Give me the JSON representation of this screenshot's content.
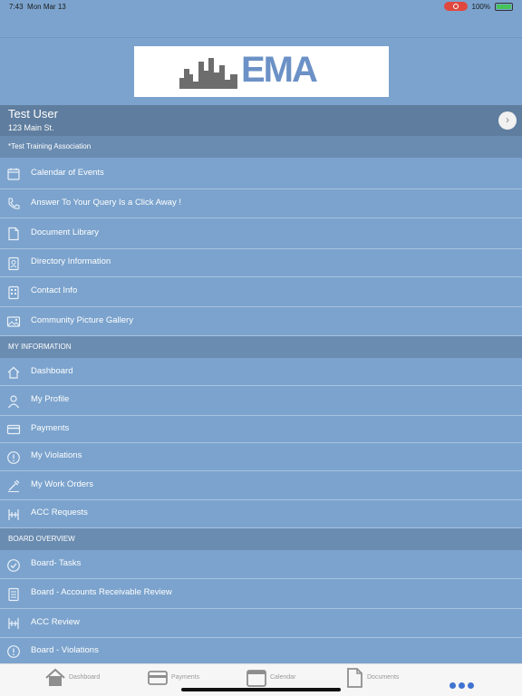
{
  "status_bar": {
    "time": "7:43",
    "date": "Mon Mar 13",
    "battery_percent": "100%",
    "battery_level": 1.0
  },
  "logo": {
    "text": "EMA"
  },
  "user": {
    "name": "Test User",
    "address": "123 Main St."
  },
  "association": {
    "label": "*Test Training Association"
  },
  "association_items": [
    {
      "label": "Calendar of Events",
      "icon": "calendar-icon"
    },
    {
      "label": "Answer To Your Query Is a Click Away !",
      "icon": "phone-icon"
    },
    {
      "label": "Document Library",
      "icon": "document-icon"
    },
    {
      "label": "Directory Information",
      "icon": "contact-card-icon"
    },
    {
      "label": "Contact Info",
      "icon": "building-icon"
    },
    {
      "label": "Community Picture Gallery",
      "icon": "picture-icon"
    }
  ],
  "my_information": {
    "header": "MY INFORMATION",
    "items": [
      {
        "label": "Dashboard",
        "icon": "home-icon"
      },
      {
        "label": "My Profile",
        "icon": "person-icon"
      },
      {
        "label": "Payments",
        "icon": "credit-card-icon"
      },
      {
        "label": "My Violations",
        "icon": "alert-icon"
      },
      {
        "label": "My Work Orders",
        "icon": "tools-icon"
      },
      {
        "label": "ACC Requests",
        "icon": "architecture-icon"
      }
    ]
  },
  "board_overview": {
    "header": "BOARD OVERVIEW",
    "items": [
      {
        "label": "Board- Tasks",
        "icon": "checkmark-icon"
      },
      {
        "label": "Board - Accounts Receivable Review",
        "icon": "ledger-icon"
      },
      {
        "label": "ACC Review",
        "icon": "architecture-icon"
      },
      {
        "label": "Board - Violations",
        "icon": "alert-icon"
      }
    ]
  },
  "tab_bar": {
    "tabs": [
      {
        "label": "Dashboard",
        "icon": "home-icon"
      },
      {
        "label": "Payments",
        "icon": "credit-card-icon"
      },
      {
        "label": "Calendar",
        "icon": "calendar-icon"
      },
      {
        "label": "Documents",
        "icon": "document-icon"
      }
    ],
    "more": "more-icon"
  },
  "colors": {
    "background": "#7ba3cd",
    "user_row": "#5f7d9e",
    "section_header": "#6a8cb1",
    "accent": "#3f73d1",
    "logo_blue": "#6b91c6"
  }
}
